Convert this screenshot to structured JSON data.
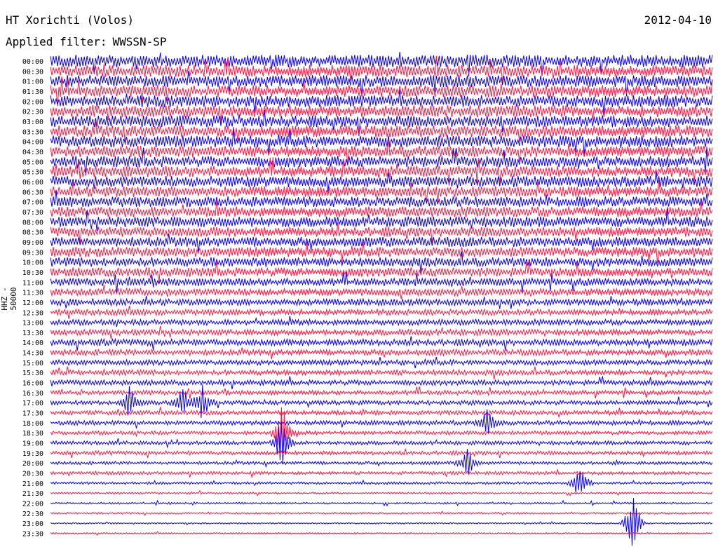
{
  "header": {
    "station": "HT Xorichti (Volos)",
    "date": "2012-04-10",
    "filter_label": "Applied filter:",
    "filter_value": "WWSSN-SP"
  },
  "channel_label": "HHZ - 50000",
  "colors": {
    "odd": "#0a00f0",
    "even": "#ff1744"
  },
  "chart_data": {
    "type": "line",
    "title": "HT Xorichti (Volos)",
    "ylabel": "HHZ - 50000",
    "time_labels": [
      "00:00",
      "00:30",
      "01:00",
      "01:30",
      "02:00",
      "02:30",
      "03:00",
      "03:30",
      "04:00",
      "04:30",
      "05:00",
      "05:30",
      "06:00",
      "06:30",
      "07:00",
      "07:30",
      "08:00",
      "08:30",
      "09:00",
      "09:30",
      "10:00",
      "10:30",
      "11:00",
      "11:30",
      "12:00",
      "12:30",
      "13:00",
      "13:30",
      "14:00",
      "14:30",
      "15:00",
      "15:30",
      "16:00",
      "16:30",
      "17:00",
      "17:30",
      "18:00",
      "18:30",
      "19:00",
      "19:30",
      "20:00",
      "20:30",
      "21:00",
      "21:30",
      "22:00",
      "22:30",
      "23:00",
      "23:30"
    ],
    "noise_level": [
      0.95,
      0.9,
      0.9,
      0.9,
      0.9,
      0.9,
      0.9,
      0.9,
      0.9,
      0.85,
      0.85,
      0.85,
      0.85,
      0.8,
      0.8,
      0.8,
      0.8,
      0.75,
      0.75,
      0.75,
      0.7,
      0.7,
      0.6,
      0.55,
      0.5,
      0.45,
      0.45,
      0.45,
      0.5,
      0.45,
      0.4,
      0.4,
      0.4,
      0.35,
      0.35,
      0.35,
      0.35,
      0.3,
      0.3,
      0.3,
      0.25,
      0.25,
      0.2,
      0.15,
      0.15,
      0.15,
      0.12,
      0.12
    ],
    "events": [
      {
        "trace": 34,
        "pos": 0.12,
        "amp": 0.9
      },
      {
        "trace": 34,
        "pos": 0.2,
        "amp": 0.85
      },
      {
        "trace": 34,
        "pos": 0.23,
        "amp": 1.0
      },
      {
        "trace": 36,
        "pos": 0.66,
        "amp": 0.8
      },
      {
        "trace": 37,
        "pos": 0.35,
        "amp": 1.6
      },
      {
        "trace": 38,
        "pos": 0.35,
        "amp": 1.5
      },
      {
        "trace": 40,
        "pos": 0.63,
        "amp": 0.8
      },
      {
        "trace": 42,
        "pos": 0.8,
        "amp": 1.1
      },
      {
        "trace": 46,
        "pos": 0.88,
        "amp": 1.8
      }
    ]
  }
}
